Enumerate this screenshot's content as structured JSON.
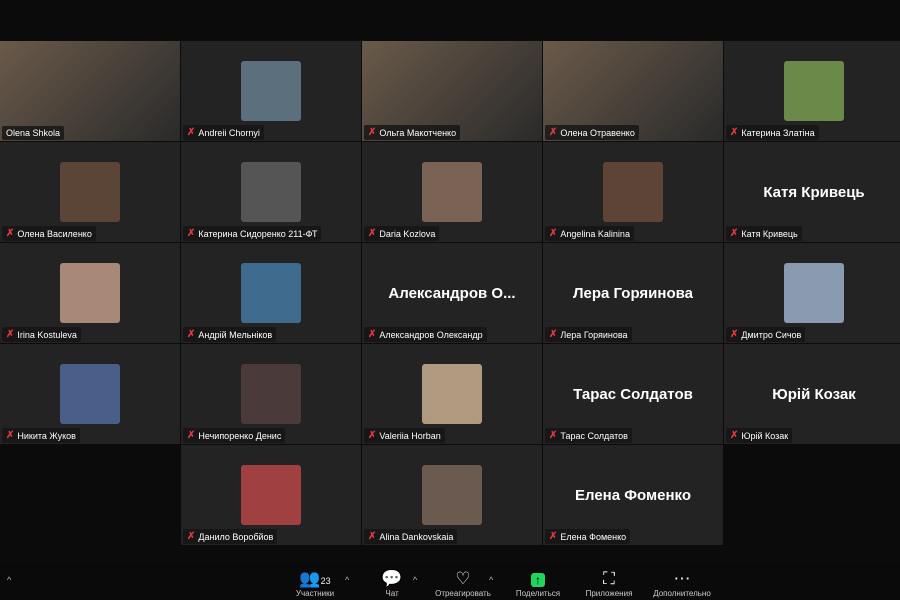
{
  "participants": [
    {
      "name": "Olena Shkola",
      "type": "video",
      "active": true,
      "muted": false
    },
    {
      "name": "Andreii Chornyi",
      "type": "photo",
      "color": "#5b6f7c",
      "muted": true
    },
    {
      "name": "Ольга Макотченко",
      "type": "video",
      "muted": true
    },
    {
      "name": "Олена Отравенко",
      "type": "video",
      "muted": true
    },
    {
      "name": "Катерина Златіна",
      "type": "photo",
      "color": "#6b8a4a",
      "muted": true
    },
    {
      "name": "Олена Василенко",
      "type": "photo",
      "color": "#5a4536",
      "muted": true
    },
    {
      "name": "Катерина Сидоренко 211-ФТ",
      "type": "photo",
      "color": "#555555",
      "muted": true
    },
    {
      "name": "Daria Kozlova",
      "type": "photo",
      "color": "#7a6355",
      "muted": true
    },
    {
      "name": "Angelina Kalinina",
      "type": "photo",
      "color": "#5e4436",
      "muted": true
    },
    {
      "name": "Катя Кривець",
      "type": "name",
      "display": "Катя Кривець",
      "muted": true
    },
    {
      "name": "Irina Kostuleva",
      "type": "photo",
      "color": "#a88878",
      "muted": true
    },
    {
      "name": "Андрій Мельніков",
      "type": "photo",
      "color": "#3f6b8e",
      "muted": true
    },
    {
      "name": "Александров Олександр",
      "type": "name",
      "display": "Александров О...",
      "muted": true
    },
    {
      "name": "Лера Горяинова",
      "type": "name",
      "display": "Лера Горяинова",
      "muted": true
    },
    {
      "name": "Дмитро Сичов",
      "type": "photo",
      "color": "#8a9bb0",
      "muted": true
    },
    {
      "name": "Никита Жуков",
      "type": "photo",
      "color": "#4a5e8a",
      "muted": true
    },
    {
      "name": "Нечипоренко Денис",
      "type": "photo",
      "color": "#4a3a3a",
      "muted": true
    },
    {
      "name": "Valeriia Horban",
      "type": "photo",
      "color": "#b09a80",
      "muted": true
    },
    {
      "name": "Тарас Солдатов",
      "type": "name",
      "display": "Тарас Солдатов",
      "muted": true
    },
    {
      "name": "Юрій Козак",
      "type": "name",
      "display": "Юрій Козак",
      "muted": true
    },
    {
      "name": "Данило Воробйов",
      "type": "photo",
      "color": "#a04040",
      "muted": true
    },
    {
      "name": "Alina Dankovskaia",
      "type": "photo",
      "color": "#6a5a50",
      "muted": true
    },
    {
      "name": "Елена Фоменко",
      "type": "name",
      "display": "Елена Фоменко",
      "muted": true
    }
  ],
  "toolbar": {
    "participants_label": "Участники",
    "participants_count": "23",
    "chat_label": "Чат",
    "react_label": "Отреагировать",
    "share_label": "Поделиться",
    "apps_label": "Приложения",
    "more_label": "Дополнительно"
  }
}
